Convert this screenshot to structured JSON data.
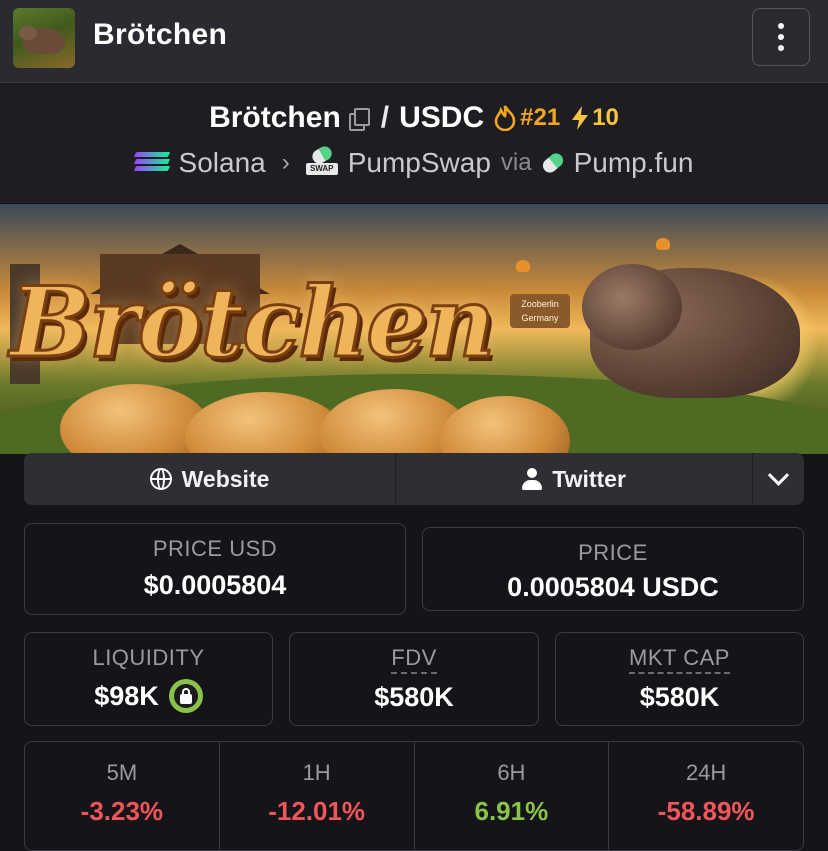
{
  "header": {
    "title": "Brötchen",
    "menu_icon": "kebab-menu-icon"
  },
  "pair": {
    "base": "Brötchen",
    "separator": "/",
    "quote": "USDC",
    "rank": "#21",
    "boosts": "10",
    "chain": "Solana",
    "dex": "PumpSwap",
    "via_label": "via",
    "launchpad": "Pump.fun"
  },
  "banner": {
    "logo_text": "Brötchen",
    "sign_line1": "Zooberlin",
    "sign_line2": "Germany"
  },
  "links": {
    "website": "Website",
    "twitter": "Twitter"
  },
  "stats": {
    "price_usd_label": "PRICE USD",
    "price_usd": "$0.0005804",
    "price_label": "PRICE",
    "price": "0.0005804 USDC",
    "liquidity_label": "LIQUIDITY",
    "liquidity": "$98K",
    "fdv_label": "FDV",
    "fdv": "$580K",
    "mktcap_label": "MKT CAP",
    "mktcap": "$580K"
  },
  "changes": [
    {
      "label": "5M",
      "value": "-3.23%"
    },
    {
      "label": "1H",
      "value": "-12.01%"
    },
    {
      "label": "6H",
      "value": "6.91%"
    },
    {
      "label": "24H",
      "value": "-58.89%"
    }
  ],
  "colors": {
    "negative": "#f0565a",
    "positive": "#8ac34a",
    "rank": "#f5a524"
  }
}
